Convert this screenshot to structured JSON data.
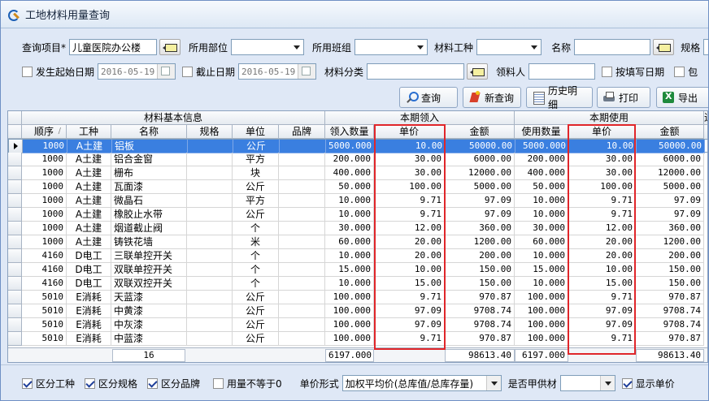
{
  "window": {
    "title": "工地材料用量查询"
  },
  "form": {
    "project_label": "查询项目*",
    "project_value": "儿童医院办公楼",
    "dept_label": "所用部位",
    "team_label": "所用班组",
    "material_type_label": "材料工种",
    "name_label": "名称",
    "spec_label": "规格",
    "start_date_label": "发生起始日期",
    "start_date_value": "2016-05-19",
    "end_date_label": "截止日期",
    "end_date_value": "2016-05-19",
    "category_label": "材料分类",
    "receiver_label": "领料人",
    "fill_date_label": "按填写日期",
    "cut_label": "包"
  },
  "toolbar": {
    "query": "查询",
    "new_query": "新查询",
    "history": "历史明细",
    "print": "打印",
    "export": "导出"
  },
  "table": {
    "group_headers": {
      "basic": "材料基本信息",
      "receive": "本期领入",
      "use": "本期使用",
      "extra": "近"
    },
    "columns": [
      "顺序",
      "工种",
      "名称",
      "规格",
      "单位",
      "品牌",
      "领入数量",
      "单价",
      "金额",
      "使用数量",
      "单价",
      "金额"
    ],
    "sort_glyph": "/",
    "rows": [
      [
        "1000",
        "A土建",
        "铝板",
        "",
        "公斤",
        "",
        "5000.000",
        "10.00",
        "50000.00",
        "5000.000",
        "10.00",
        "50000.00"
      ],
      [
        "1000",
        "A土建",
        "铝合金窗",
        "",
        "平方",
        "",
        "200.000",
        "30.00",
        "6000.00",
        "200.000",
        "30.00",
        "6000.00"
      ],
      [
        "1000",
        "A土建",
        "栅布",
        "",
        "块",
        "",
        "400.000",
        "30.00",
        "12000.00",
        "400.000",
        "30.00",
        "12000.00"
      ],
      [
        "1000",
        "A土建",
        "瓦面漆",
        "",
        "公斤",
        "",
        "50.000",
        "100.00",
        "5000.00",
        "50.000",
        "100.00",
        "5000.00"
      ],
      [
        "1000",
        "A土建",
        "微晶石",
        "",
        "平方",
        "",
        "10.000",
        "9.71",
        "97.09",
        "10.000",
        "9.71",
        "97.09"
      ],
      [
        "1000",
        "A土建",
        "橡胶止水带",
        "",
        "公斤",
        "",
        "10.000",
        "9.71",
        "97.09",
        "10.000",
        "9.71",
        "97.09"
      ],
      [
        "1000",
        "A土建",
        "烟道截止阀",
        "",
        "个",
        "",
        "30.000",
        "12.00",
        "360.00",
        "30.000",
        "12.00",
        "360.00"
      ],
      [
        "1000",
        "A土建",
        "铸铁花墙",
        "",
        "米",
        "",
        "60.000",
        "20.00",
        "1200.00",
        "60.000",
        "20.00",
        "1200.00"
      ],
      [
        "4160",
        "D电工",
        "三联单控开关",
        "",
        "个",
        "",
        "10.000",
        "20.00",
        "200.00",
        "10.000",
        "20.00",
        "200.00"
      ],
      [
        "4160",
        "D电工",
        "双联单控开关",
        "",
        "个",
        "",
        "15.000",
        "10.00",
        "150.00",
        "15.000",
        "10.00",
        "150.00"
      ],
      [
        "4160",
        "D电工",
        "双联双控开关",
        "",
        "个",
        "",
        "10.000",
        "15.00",
        "150.00",
        "10.000",
        "15.00",
        "150.00"
      ],
      [
        "5010",
        "E消耗",
        "天蓝漆",
        "",
        "公斤",
        "",
        "100.000",
        "9.71",
        "970.87",
        "100.000",
        "9.71",
        "970.87"
      ],
      [
        "5010",
        "E消耗",
        "中黄漆",
        "",
        "公斤",
        "",
        "100.000",
        "97.09",
        "9708.74",
        "100.000",
        "97.09",
        "9708.74"
      ],
      [
        "5010",
        "E消耗",
        "中灰漆",
        "",
        "公斤",
        "",
        "100.000",
        "97.09",
        "9708.74",
        "100.000",
        "97.09",
        "9708.74"
      ],
      [
        "5010",
        "E消耗",
        "中蓝漆",
        "",
        "公斤",
        "",
        "100.000",
        "9.71",
        "970.87",
        "100.000",
        "9.71",
        "970.87"
      ]
    ],
    "footer": {
      "count": "16",
      "recv_qty": "6197.000",
      "recv_amt": "98613.40",
      "use_qty": "6197.000",
      "use_amt": "98613.40"
    }
  },
  "bottom": {
    "by_type": "区分工种",
    "by_spec": "区分规格",
    "by_brand": "区分品牌",
    "usage_ne": "用量不等于0",
    "price_form_label": "单价形式",
    "price_form_value": "加权平均价(总库值/总库存量)",
    "supply_label": "是否甲供材",
    "show_price": "显示单价"
  },
  "colors": {
    "selected_row": "#3a7fe0",
    "highlight": "#e0262a",
    "frame": "#dfe8f6"
  }
}
